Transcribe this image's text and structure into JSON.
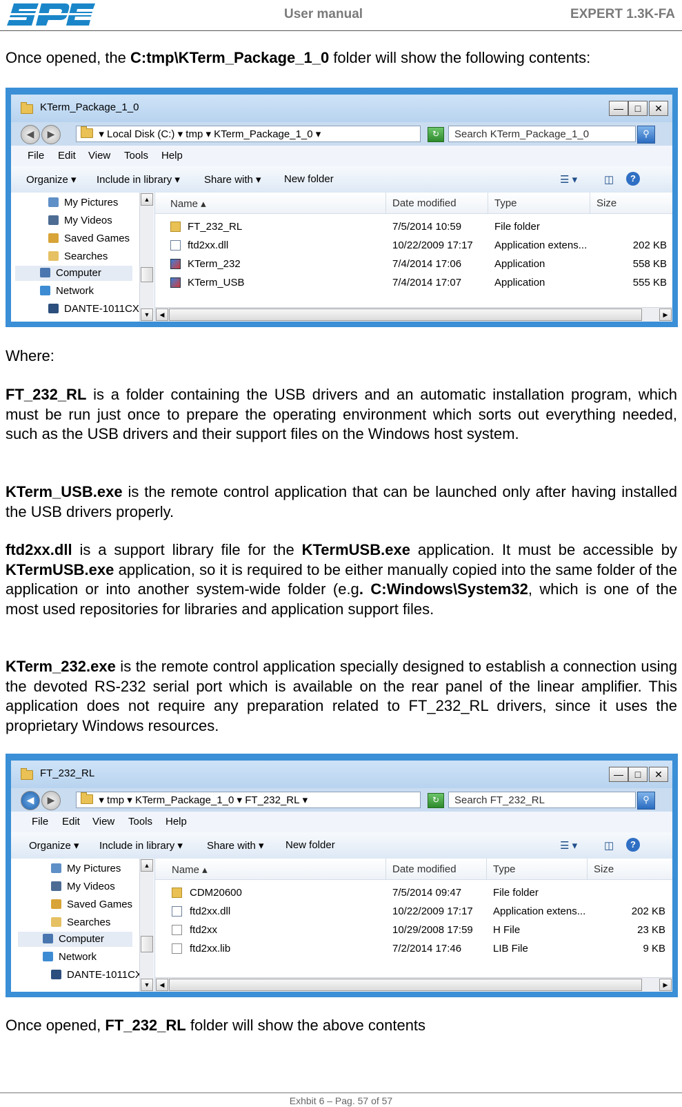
{
  "header": {
    "title": "User manual",
    "model": "EXPERT 1.3K-FA"
  },
  "intro": {
    "prefix": "Once opened, the ",
    "path": "C:tmp\\KTerm_Package_1_0",
    "suffix": " folder will show the following contents:"
  },
  "where_label": "Where:",
  "desc": {
    "ft232": {
      "name": "FT_232_RL",
      "text": " is a folder containing the USB drivers and an automatic installation program, which must be run just once to prepare the operating environment which sorts out everything needed, such as the USB drivers and their support files on the Windows host system."
    },
    "ktermusb": {
      "name": "KTerm_USB.exe",
      "text": " is the remote control application that can be launched only after having installed the USB drivers properly."
    },
    "ftd2xx": {
      "name": "ftd2xx.dll",
      "t1": "  is a support library file for the ",
      "b1": "KTermUSB.exe",
      "t2": " application. It must be accessible by ",
      "b2": "KTermUSB.exe",
      "t3": " application, so it is required to be either manually copied into the same folder of the application or into another system-wide folder (e.g",
      "b3": ". C:Windows\\System32",
      "t4": ", which is one of the most used repositories for libraries and application support files."
    },
    "kterm232": {
      "name": "KTerm_232.exe",
      "text": " is the remote control application specially designed to establish a connection using the devoted RS-232 serial port which is available on the rear panel  of the linear amplifier. This application does not require any preparation related to FT_232_RL drivers, since it uses the proprietary Windows resources."
    }
  },
  "outro": {
    "prefix": "Once opened, ",
    "name": "FT_232_RL",
    "suffix": " folder will show the above contents"
  },
  "footer": "Exhbit 6 – Pag. 57 of  57",
  "explorer": {
    "menu": [
      "File",
      "Edit",
      "View",
      "Tools",
      "Help"
    ],
    "toolbar": {
      "organize": "Organize",
      "include": "Include in library",
      "share": "Share with",
      "newfolder": "New folder"
    },
    "columns": {
      "name": "Name",
      "date": "Date modified",
      "type": "Type",
      "size": "Size"
    },
    "nav": [
      "My Pictures",
      "My Videos",
      "Saved Games",
      "Searches",
      "Computer",
      "Network",
      "DANTE-1011CX"
    ],
    "win1": {
      "title": "KTerm_Package_1_0",
      "crumbs": [
        "Local Disk (C:)",
        "tmp",
        "KTerm_Package_1_0"
      ],
      "search": "Search KTerm_Package_1_0",
      "files": [
        {
          "name": "FT_232_RL",
          "date": "7/5/2014 10:59",
          "type": "File folder",
          "size": ""
        },
        {
          "name": "ftd2xx.dll",
          "date": "10/22/2009 17:17",
          "type": "Application extens...",
          "size": "202 KB"
        },
        {
          "name": "KTerm_232",
          "date": "7/4/2014 17:06",
          "type": "Application",
          "size": "558 KB"
        },
        {
          "name": "KTerm_USB",
          "date": "7/4/2014 17:07",
          "type": "Application",
          "size": "555 KB"
        }
      ]
    },
    "win2": {
      "title": "FT_232_RL",
      "crumbs": [
        "tmp",
        "KTerm_Package_1_0",
        "FT_232_RL"
      ],
      "search": "Search FT_232_RL",
      "files": [
        {
          "name": "CDM20600",
          "date": "7/5/2014 09:47",
          "type": "File folder",
          "size": ""
        },
        {
          "name": "ftd2xx.dll",
          "date": "10/22/2009 17:17",
          "type": "Application extens...",
          "size": "202 KB"
        },
        {
          "name": "ftd2xx",
          "date": "10/29/2008 17:59",
          "type": "H File",
          "size": "23 KB"
        },
        {
          "name": "ftd2xx.lib",
          "date": "7/2/2014 17:46",
          "type": "LIB File",
          "size": "9 KB"
        }
      ]
    }
  }
}
